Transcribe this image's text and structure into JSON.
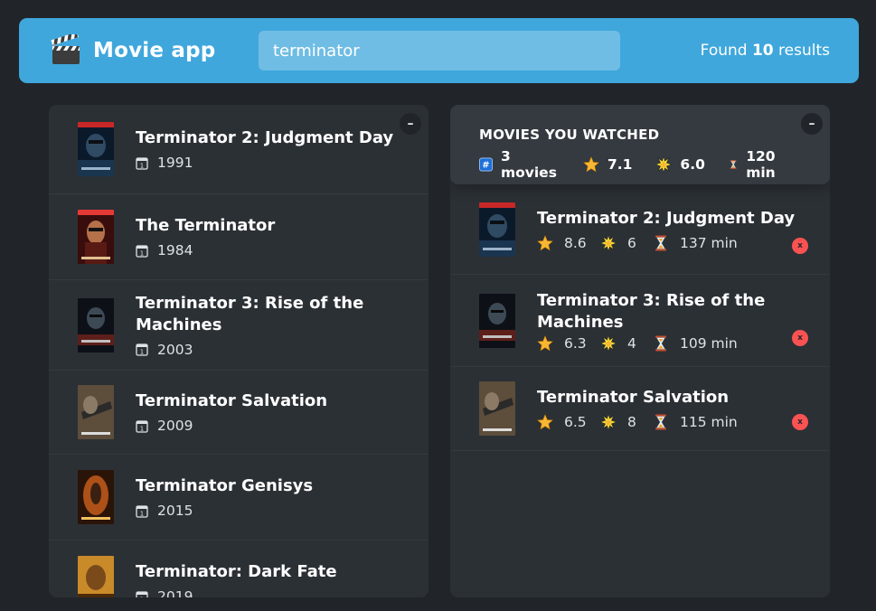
{
  "navbar": {
    "app_name": "Movie app",
    "logo_icon": "clapper-board-icon",
    "search_value": "terminator",
    "results_prefix": "Found ",
    "results_count": "10",
    "results_suffix": " results"
  },
  "search_results": {
    "toggle_label": "–",
    "items": [
      {
        "title": "Terminator 2: Judgment Day",
        "year": "1991"
      },
      {
        "title": "The Terminator",
        "year": "1984"
      },
      {
        "title": "Terminator 3: Rise of the Machines",
        "year": "2003"
      },
      {
        "title": "Terminator Salvation",
        "year": "2009"
      },
      {
        "title": "Terminator Genisys",
        "year": "2015"
      },
      {
        "title": "Terminator: Dark Fate",
        "year": "2019"
      }
    ]
  },
  "watched": {
    "toggle_label": "–",
    "summary": {
      "heading": "MOVIES YOU WATCHED",
      "count": "3 movies",
      "avg_imdb": "7.1",
      "avg_user": "6.0",
      "avg_runtime": "120 min"
    },
    "items": [
      {
        "title": "Terminator 2: Judgment Day",
        "imdb": "8.6",
        "user": "6",
        "runtime": "137 min"
      },
      {
        "title": "Terminator 3: Rise of the Machines",
        "imdb": "6.3",
        "user": "4",
        "runtime": "109 min"
      },
      {
        "title": "Terminator Salvation",
        "imdb": "6.5",
        "user": "8",
        "runtime": "115 min"
      }
    ],
    "delete_label": "x"
  },
  "colors": {
    "navbar": "#3fa7dc",
    "background": "#212529",
    "box": "#2b3035",
    "summary": "#343a40",
    "delete": "#fa5252"
  }
}
